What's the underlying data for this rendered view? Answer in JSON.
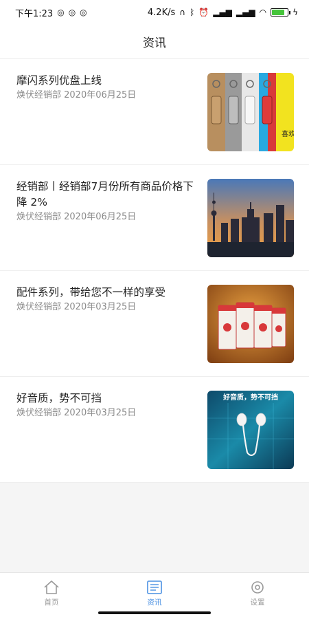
{
  "status_bar": {
    "time": "下午1:23",
    "network_speed": "4.2K/s",
    "icons": [
      "notification-icon",
      "notification-icon",
      "notification-icon",
      "headphones-icon",
      "bluetooth-icon",
      "alarm-icon",
      "signal-icon",
      "signal-icon",
      "wifi-icon",
      "battery-icon",
      "charging-icon"
    ],
    "battery_level": 0.8
  },
  "header": {
    "title": "资讯"
  },
  "news": [
    {
      "title": "摩闪系列优盘上线",
      "meta": "焕伏经销部 2020年06月25日",
      "thumb": "usb-drives"
    },
    {
      "title": "经销部丨经销部7月份所有商品价格下降 2%",
      "meta": "焕伏经销部 2020年06月25日",
      "thumb": "city-skyline"
    },
    {
      "title": "配件系列，带给您不一样的享受",
      "meta": "焕伏经销部 2020年03月25日",
      "thumb": "accessory-boxes"
    },
    {
      "title": "好音质，势不可挡",
      "meta": "焕伏经销部 2020年03月25日",
      "thumb": "earphones",
      "thumb_caption": "好音质，势不可挡"
    }
  ],
  "thumb_texts": {
    "usb_tag": "喜欢"
  },
  "tabbar": {
    "tabs": [
      {
        "label": "首页",
        "icon": "home-icon",
        "active": false
      },
      {
        "label": "资讯",
        "icon": "news-icon",
        "active": true
      },
      {
        "label": "设置",
        "icon": "settings-icon",
        "active": false
      }
    ],
    "active_color": "#4a90e2",
    "inactive_color": "#999999"
  }
}
